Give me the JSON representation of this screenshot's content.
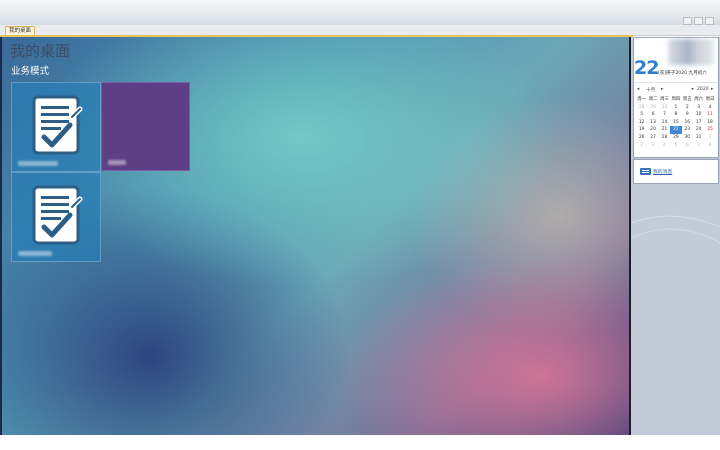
{
  "tab": {
    "label": "我的桌面"
  },
  "desktop": {
    "title": "我的桌面",
    "section_title": "业务模式",
    "tiles": [
      {
        "icon": "document-check-icon",
        "color": "#2c7ab3"
      },
      {
        "icon": "",
        "color": "#5e3f86"
      },
      {
        "icon": "document-check-icon",
        "color": "#2c7ab3"
      }
    ]
  },
  "calendar": {
    "day_number": "22",
    "day_label": "[农]庚子2020 九月初六",
    "month_label": "十月",
    "year_label": "2020",
    "prev_month_arrow": "◂",
    "next_month_arrow": "▸",
    "prev_year_arrow": "◂",
    "next_year_arrow": "▸",
    "weekdays": [
      "周一",
      "周二",
      "周三",
      "周四",
      "周五",
      "周六",
      "周日"
    ],
    "weeks": [
      [
        "28",
        "29",
        "30",
        "1",
        "2",
        "3",
        "4"
      ],
      [
        "5",
        "6",
        "7",
        "8",
        "9",
        "10",
        "11"
      ],
      [
        "12",
        "13",
        "14",
        "15",
        "16",
        "17",
        "18"
      ],
      [
        "19",
        "20",
        "21",
        "22",
        "23",
        "24",
        "25"
      ],
      [
        "26",
        "27",
        "28",
        "29",
        "30",
        "31",
        "1"
      ],
      [
        "2",
        "3",
        "4",
        "5",
        "6",
        "7",
        "8"
      ]
    ],
    "today": "22"
  },
  "info": {
    "link_label": "我的消息"
  },
  "colors": {
    "accent": "#2d7fd2",
    "tab_border": "#d9b860",
    "sidebar": "#c3cbd8"
  }
}
